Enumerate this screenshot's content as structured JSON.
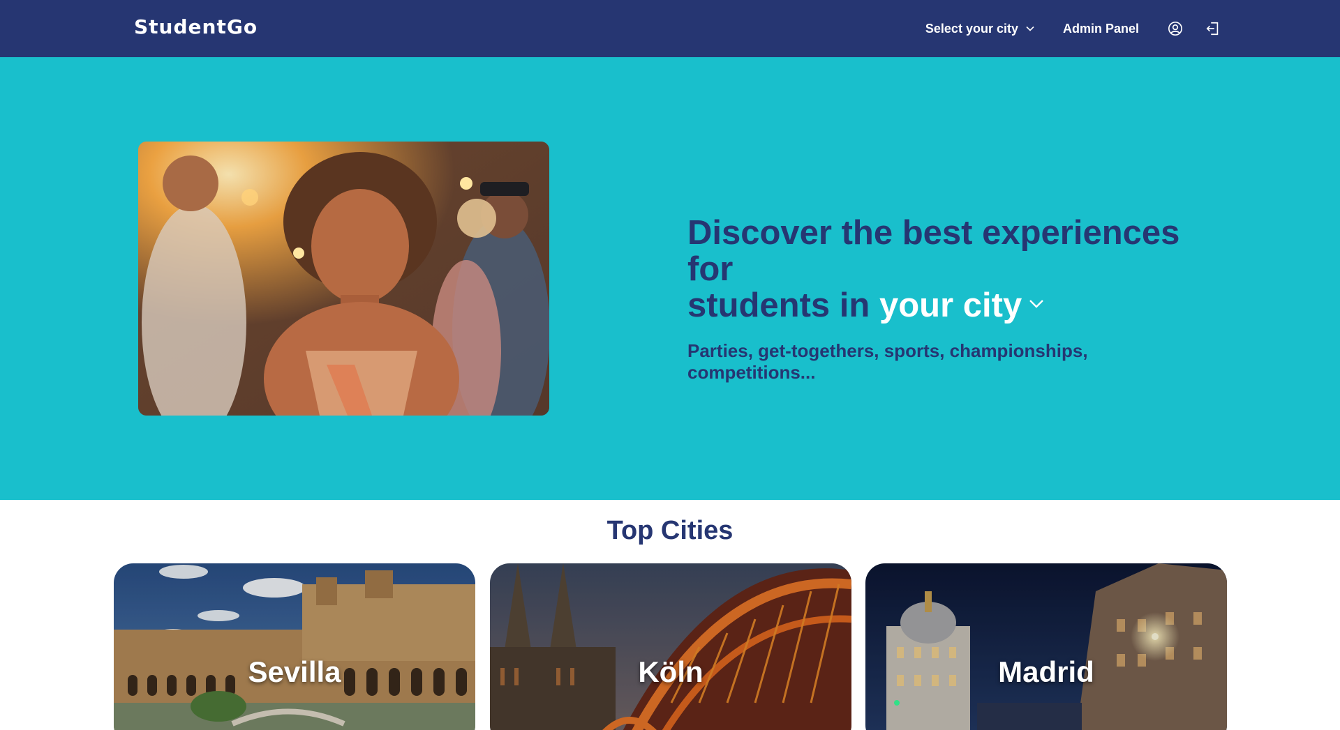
{
  "brand": "StudentGo",
  "nav": {
    "city_select": "Select your city",
    "admin": "Admin Panel",
    "profile_icon": "user-circle-icon",
    "logout_icon": "logout-icon"
  },
  "hero": {
    "title_part1": "Discover the best experiences for",
    "title_part2": "students in ",
    "title_highlight": "your city",
    "subtitle": "Parties, get-togethers, sports, championships, competitions...",
    "image_alt": "Smiling student dancing at a party"
  },
  "top_cities": {
    "title": "Top Cities",
    "cities": [
      {
        "name": "Sevilla"
      },
      {
        "name": "Köln"
      },
      {
        "name": "Madrid"
      }
    ]
  },
  "colors": {
    "navbar": "#263672",
    "hero_bg": "#19bfcc",
    "text_dark": "#263672",
    "white": "#ffffff"
  }
}
